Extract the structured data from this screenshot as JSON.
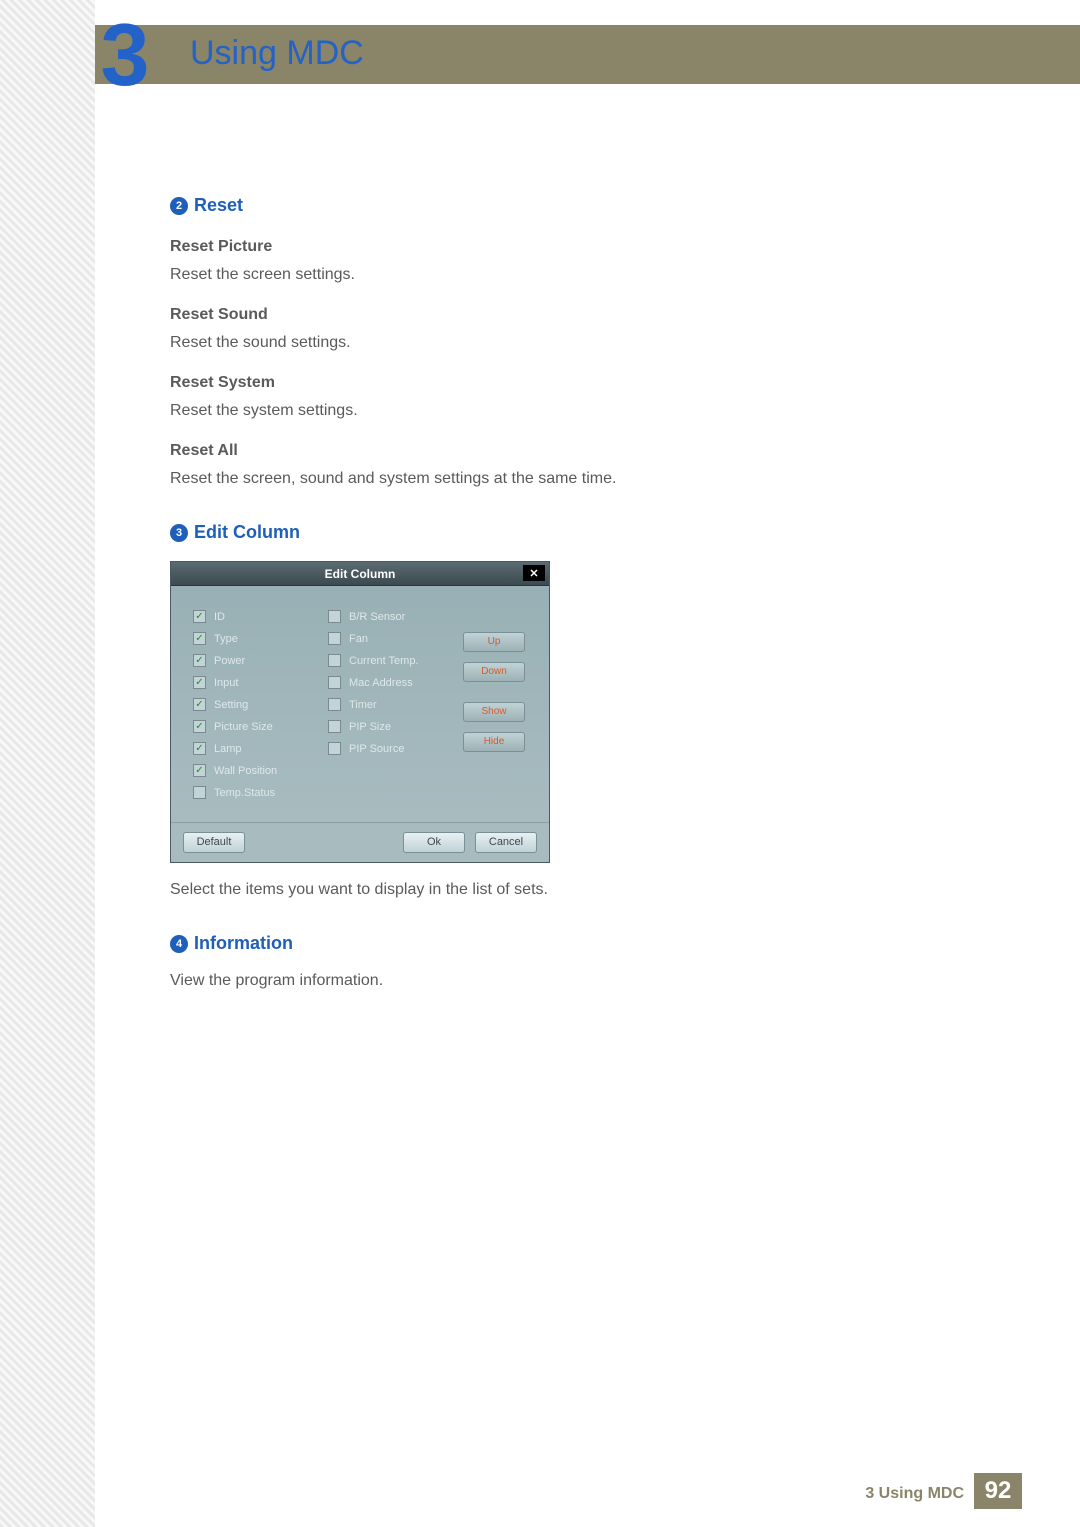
{
  "header": {
    "chapter_number": "3",
    "chapter_title": "Using MDC"
  },
  "sections": {
    "reset": {
      "bullet": "2",
      "title": "Reset",
      "items": [
        {
          "heading": "Reset Picture",
          "body": "Reset the screen settings."
        },
        {
          "heading": "Reset Sound",
          "body": "Reset the sound settings."
        },
        {
          "heading": "Reset System",
          "body": "Reset the system settings."
        },
        {
          "heading": "Reset All",
          "body": "Reset the screen, sound and system settings at the same time."
        }
      ]
    },
    "edit_column": {
      "bullet": "3",
      "title": "Edit Column",
      "caption": "Select the items you want to display in the list of sets."
    },
    "information": {
      "bullet": "4",
      "title": "Information",
      "body": "View the program information."
    }
  },
  "dialog": {
    "title": "Edit Column",
    "close": "✕",
    "col1": [
      {
        "label": "ID",
        "checked": true
      },
      {
        "label": "Type",
        "checked": true
      },
      {
        "label": "Power",
        "checked": true
      },
      {
        "label": "Input",
        "checked": true
      },
      {
        "label": "Setting",
        "checked": true
      },
      {
        "label": "Picture Size",
        "checked": true
      },
      {
        "label": "Lamp",
        "checked": true
      },
      {
        "label": "Wall Position",
        "checked": true
      },
      {
        "label": "Temp.Status",
        "checked": false
      }
    ],
    "col2": [
      {
        "label": "B/R Sensor",
        "checked": false
      },
      {
        "label": "Fan",
        "checked": false
      },
      {
        "label": "Current Temp.",
        "checked": false
      },
      {
        "label": "Mac Address",
        "checked": false
      },
      {
        "label": "Timer",
        "checked": false
      },
      {
        "label": "PIP Size",
        "checked": false
      },
      {
        "label": "PIP Source",
        "checked": false
      }
    ],
    "side_buttons": {
      "up": "Up",
      "down": "Down",
      "show": "Show",
      "hide": "Hide"
    },
    "footer": {
      "default": "Default",
      "ok": "Ok",
      "cancel": "Cancel"
    }
  },
  "footer": {
    "label": "3 Using MDC",
    "page": "92"
  }
}
